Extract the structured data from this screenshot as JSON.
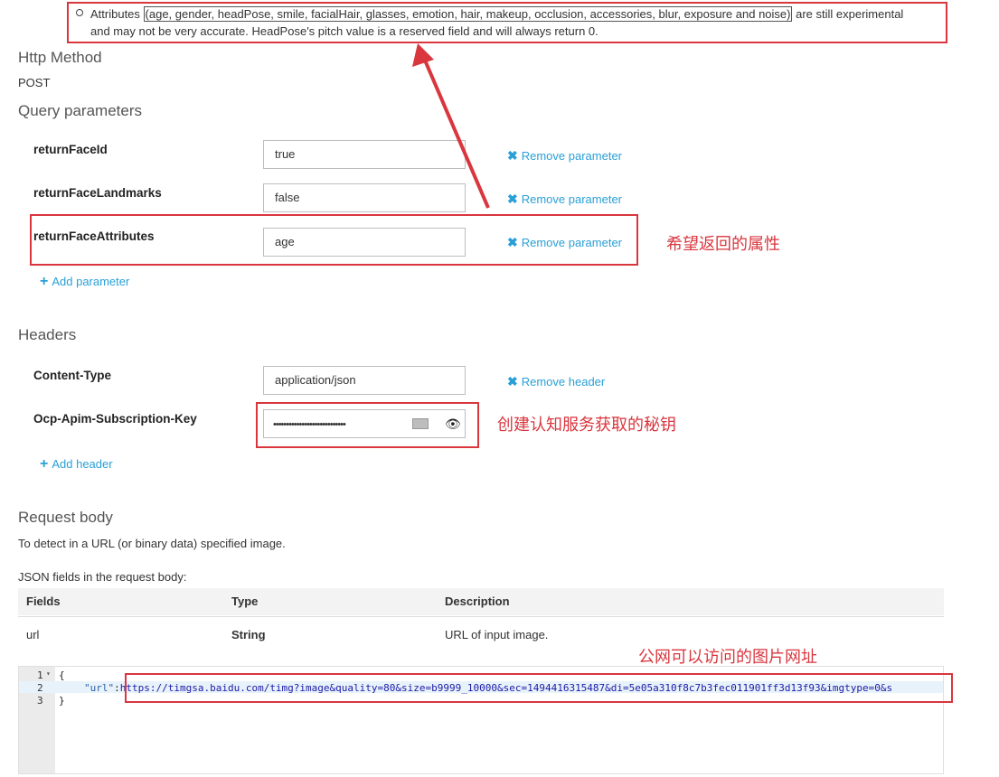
{
  "note": {
    "line1_prefix": "Attributes ",
    "line1_boxed": "(age, gender, headPose, smile, facialHair, glasses, emotion, hair, makeup, occlusion, accessories, blur, exposure and noise)",
    "line1_suffix": " are still experimental",
    "line2": "and may not be very accurate. HeadPose's pitch value is a reserved field and will always return 0."
  },
  "http_method": {
    "title": "Http Method",
    "value": "POST"
  },
  "query": {
    "title": "Query parameters",
    "params": [
      {
        "name": "returnFaceId",
        "value": "true",
        "remove": "Remove parameter"
      },
      {
        "name": "returnFaceLandmarks",
        "value": "false",
        "remove": "Remove parameter"
      },
      {
        "name": "returnFaceAttributes",
        "value": "age",
        "remove": "Remove parameter"
      }
    ],
    "add": "Add parameter"
  },
  "headers": {
    "title": "Headers",
    "items": [
      {
        "name": "Content-Type",
        "value": "application/json",
        "remove": "Remove header"
      },
      {
        "name": "Ocp-Apim-Subscription-Key",
        "value": "••••••••••••••••••••••••••••"
      }
    ],
    "add": "Add header"
  },
  "request_body": {
    "title": "Request body",
    "desc": "To detect in a URL (or binary data) specified image.",
    "json_label": "JSON fields in the request body:",
    "columns": [
      "Fields",
      "Type",
      "Description"
    ],
    "rows": [
      {
        "field": "url",
        "type": "String",
        "description": "URL of input image."
      }
    ]
  },
  "editor": {
    "line_numbers": [
      "1",
      "2",
      "3"
    ],
    "line1": "{",
    "key": "\"url\"",
    "colon": ":",
    "url": "https://timgsa.baidu.com/timg?image&quality=80&size=b9999_10000&sec=1494416315487&di=5e05a310f8c7b3fec011901ff3d13f93&imgtype=0&s",
    "line3": "}"
  },
  "annotations": {
    "attributes": "希望返回的属性",
    "key": "创建认知服务获取的秘钥",
    "url": "公网可以访问的图片网址"
  },
  "colors": {
    "accent": "#2a9fd6",
    "annotation": "#d9363e"
  }
}
